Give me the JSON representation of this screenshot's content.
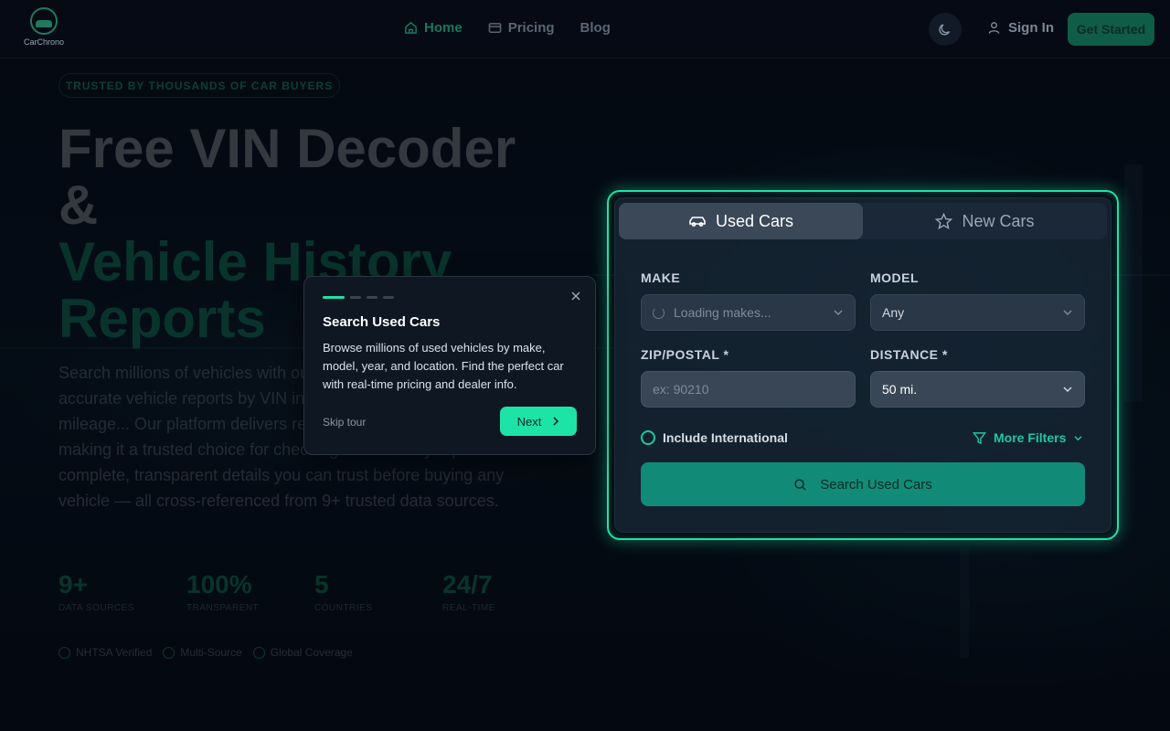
{
  "brand": {
    "name": "CarChrono"
  },
  "nav": {
    "items": [
      {
        "label": "Home",
        "icon": "home-icon",
        "active": true
      },
      {
        "label": "Pricing",
        "icon": "card-icon",
        "active": false
      },
      {
        "label": "Blog",
        "icon": "",
        "active": false
      }
    ],
    "theme_icon": "moon-icon",
    "sign_in": "Sign In",
    "get_started": "Get Started"
  },
  "hero": {
    "badge": "TRUSTED BY THOUSANDS OF CAR BUYERS",
    "title_line1": "Free VIN Decoder",
    "title_line2": "&",
    "title_line3": "Vehicle History",
    "title_line4": "Reports",
    "description": "Search millions of vehicles with our free VIN decoder and get accurate vehicle reports by VIN including ownership records, mileage... Our platform delivers reliable, scalable results, making it a trusted choice for checking a car history report. Get complete, transparent details you can trust before buying any vehicle — all cross-referenced from 9+ trusted data sources.",
    "stats": [
      {
        "value": "9+",
        "label": "DATA SOURCES"
      },
      {
        "value": "100%",
        "label": "TRANSPARENT"
      },
      {
        "value": "5",
        "label": "COUNTRIES"
      },
      {
        "value": "24/7",
        "label": "REAL-TIME"
      }
    ],
    "badges": [
      "NHTSA Verified",
      "Multi-Source",
      "Global Coverage"
    ]
  },
  "search": {
    "tabs": [
      {
        "label": "Used Cars",
        "icon": "car-icon",
        "active": true
      },
      {
        "label": "New Cars",
        "icon": "star-icon",
        "active": false
      }
    ],
    "make_label": "MAKE",
    "make_value": "Loading makes...",
    "model_label": "MODEL",
    "model_value": "Any",
    "zip_label": "ZIP/POSTAL *",
    "zip_placeholder": "ex: 90210",
    "distance_label": "DISTANCE *",
    "distance_value": "50 mi.",
    "include_international": "Include International",
    "more_filters": "More Filters",
    "submit": "Search Used Cars"
  },
  "tour": {
    "step": 1,
    "total_steps": 4,
    "title": "Search Used Cars",
    "text": "Browse millions of used vehicles by make, model, year, and location. Find the perfect car with real-time pricing and dealer info.",
    "skip": "Skip tour",
    "next": "Next"
  },
  "colors": {
    "accent": "#1ee3a6",
    "brand_green": "#0f5a45",
    "button_teal": "#118b78",
    "background": "#070d18"
  }
}
